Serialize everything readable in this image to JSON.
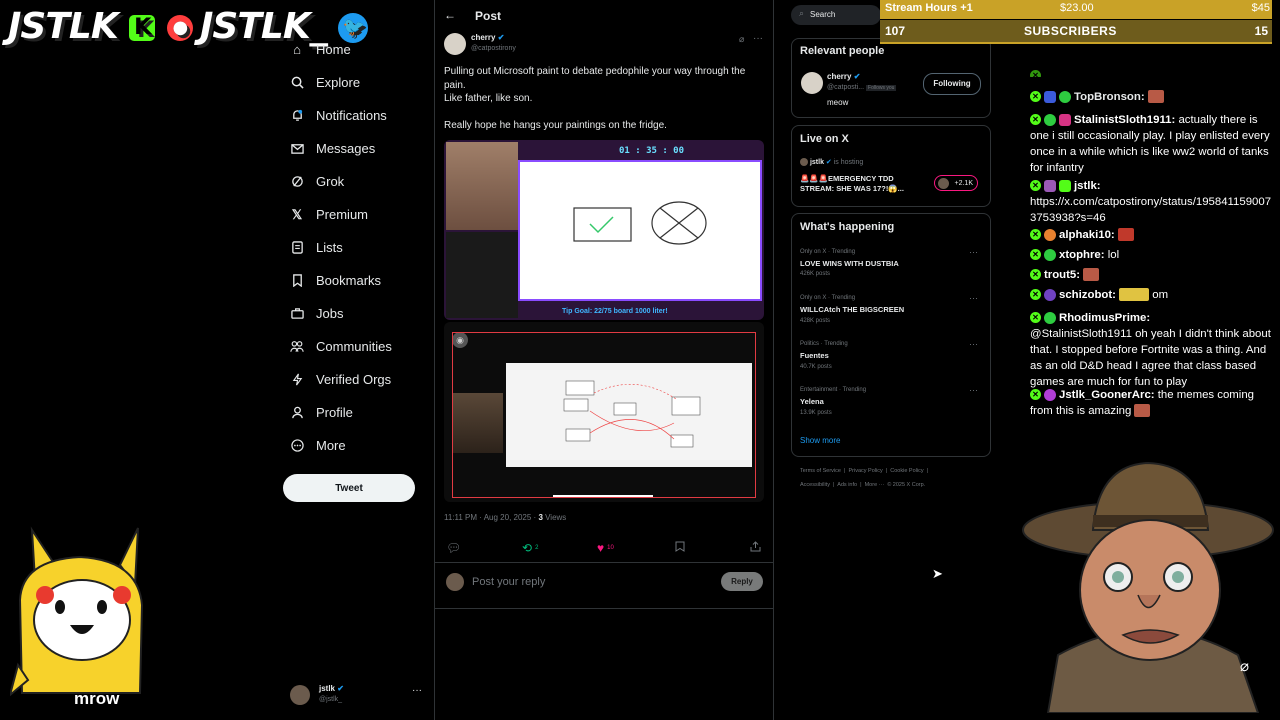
{
  "overlay": {
    "logo_left": "JSTLK",
    "logo_left_badge_k": "K",
    "logo_left_badge_yt": "●",
    "logo_right": "JSTLK_",
    "mascot_caption": "mrow"
  },
  "nav": {
    "items": [
      {
        "label": "Home",
        "icon": "home-icon"
      },
      {
        "label": "Explore",
        "icon": "search-icon"
      },
      {
        "label": "Notifications",
        "icon": "bell-icon"
      },
      {
        "label": "Messages",
        "icon": "mail-icon"
      },
      {
        "label": "Grok",
        "icon": "grok-icon"
      },
      {
        "label": "Premium",
        "icon": "x-logo-icon"
      },
      {
        "label": "Lists",
        "icon": "list-icon"
      },
      {
        "label": "Bookmarks",
        "icon": "bookmark-icon"
      },
      {
        "label": "Jobs",
        "icon": "briefcase-icon"
      },
      {
        "label": "Communities",
        "icon": "people-icon"
      },
      {
        "label": "Verified Orgs",
        "icon": "lightning-icon"
      },
      {
        "label": "Profile",
        "icon": "person-icon"
      },
      {
        "label": "More",
        "icon": "more-circle-icon"
      }
    ],
    "tweet_button": "Tweet",
    "account_name": "jstlk",
    "account_handle": "@jstlk_"
  },
  "post": {
    "header": "Post",
    "author_name": "cherry",
    "author_handle": "@catpostirony",
    "text_line1": "Pulling out Microsoft paint to debate pedophile your way through the",
    "text_line2": "pain.",
    "text_line3": "Like father, like son.",
    "text_line4": "Really hope he hangs your paintings on the fridge.",
    "stream_timer": "01 : 35 : 00",
    "stream_banner": "Tip Goal:  22/75 board 1000 liter!",
    "timestamp": "11:11 PM · Aug 20, 2025 · ",
    "views_count": "3",
    "views_label": " Views",
    "retweets": "2",
    "likes": "10",
    "reply_placeholder": "Post your reply",
    "reply_button": "Reply"
  },
  "sidebar": {
    "search_placeholder": "Search",
    "relevant_title": "Relevant people",
    "relevant_name": "cherry",
    "relevant_handle": "@catposti...",
    "relevant_follows_you": "Follows you",
    "relevant_bio": "meow",
    "following_button": "Following",
    "live_title": "Live on X",
    "live_host": "jstlk",
    "live_hosting": "is hosting",
    "live_stream_title": "🚨🚨🚨EMERGENCY TDD STREAM: SHE WAS 17?!😱...",
    "live_count": "+2.1K",
    "happening_title": "What's happening",
    "trends": [
      {
        "meta": "Only on X · Trending",
        "name": "LOVE WINS WITH DUSTBIA",
        "posts": "426K posts"
      },
      {
        "meta": "Only on X · Trending",
        "name": "WILLCAtch THE BIGSCREEN",
        "posts": "428K posts"
      },
      {
        "meta": "Politics · Trending",
        "name": "Fuentes",
        "posts": "40.7K posts"
      },
      {
        "meta": "Entertainment · Trending",
        "name": "Yelena",
        "posts": "13.9K posts"
      }
    ],
    "show_more": "Show more",
    "footer_line1": "Terms of Service  |  Privacy Policy  |  Cookie Policy  |",
    "footer_line2": "Accessibility  |  Ads info  |  More ···  © 2025 X Corp."
  },
  "stats": {
    "stream_hours_label": "Stream Hours +1",
    "stream_hours_amount": "$23.00",
    "stream_hours_right": "$45",
    "subs_count": "107",
    "subs_label": "SUBSCRIBERS",
    "subs_right": "15"
  },
  "chat": [
    {
      "user": "TopBronson:",
      "msg": ""
    },
    {
      "user": "StalinistSloth1911:",
      "msg": " actually there is one i still occasionally play. I play enlisted every once in a while which is like ww2 world of tanks for infantry"
    },
    {
      "user": "jstlk:",
      "msg": ""
    },
    {
      "user": "",
      "msg": "https://x.com/catpostirony/status/1958411590073753938?s=46"
    },
    {
      "user": "alphaki10:",
      "msg": ""
    },
    {
      "user": "xtophre:",
      "msg": " lol"
    },
    {
      "user": "trout5:",
      "msg": ""
    },
    {
      "user": "schizobot:",
      "msg": " om"
    },
    {
      "user": "RhodimusPrime:",
      "msg": ""
    },
    {
      "user": "",
      "msg": "@StalinistSloth1911 oh yeah I didn't think about that. I stopped before Fortnite was a thing. And as an old D&D head I agree that class based games are much for fun to play"
    },
    {
      "user": "Jstlk_GoonerArc:",
      "msg": " the memes coming from this is amazing"
    }
  ],
  "colors": {
    "accent_blue": "#1d9bf0",
    "kick_green": "#53fc18",
    "like_pink": "#f91880",
    "retweet_green": "#00ba7c",
    "stats_gold": "#c9a227"
  }
}
